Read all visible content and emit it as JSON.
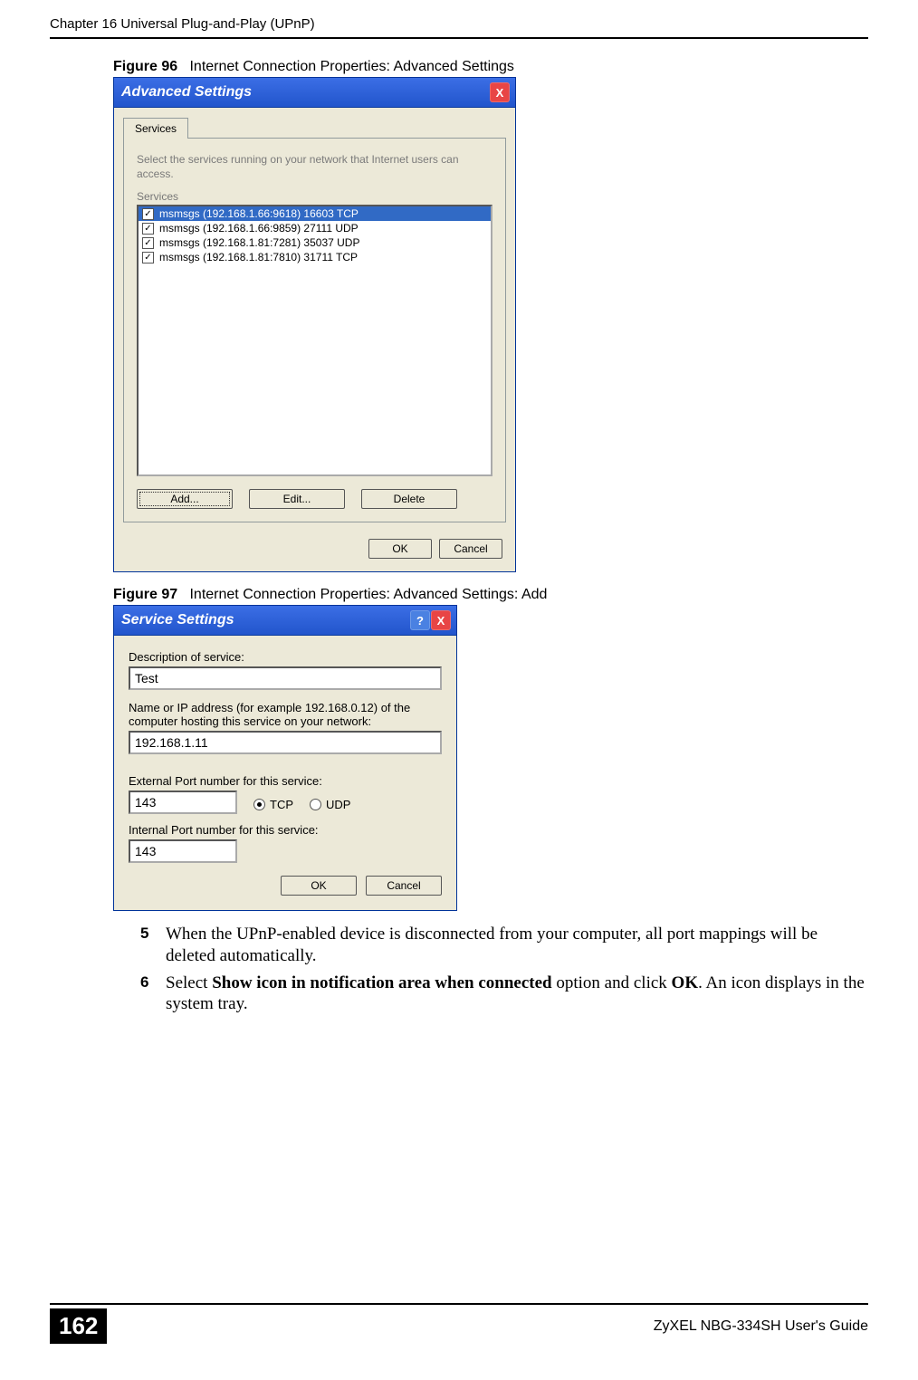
{
  "header": {
    "chapter": "Chapter 16 Universal Plug-and-Play (UPnP)"
  },
  "figure96": {
    "label": "Figure 96",
    "caption": "Internet Connection Properties: Advanced Settings"
  },
  "dlg1": {
    "title": "Advanced Settings",
    "tab": "Services",
    "instructions": "Select the services running on your network that Internet users can access.",
    "group": "Services",
    "items": [
      {
        "text": "msmsgs (192.168.1.66:9618) 16603 TCP",
        "selected": true
      },
      {
        "text": "msmsgs (192.168.1.66:9859) 27111 UDP",
        "selected": false
      },
      {
        "text": "msmsgs (192.168.1.81:7281) 35037 UDP",
        "selected": false
      },
      {
        "text": "msmsgs (192.168.1.81:7810) 31711 TCP",
        "selected": false
      }
    ],
    "btnAdd": "Add...",
    "btnEdit": "Edit...",
    "btnDelete": "Delete",
    "btnOK": "OK",
    "btnCancel": "Cancel"
  },
  "figure97": {
    "label": "Figure 97",
    "caption": "Internet Connection Properties: Advanced Settings: Add"
  },
  "dlg2": {
    "title": "Service Settings",
    "descLabel": "Description of service:",
    "descValue": "Test",
    "hostLabel": "Name or IP address (for example 192.168.0.12) of the computer hosting this service on your network:",
    "hostValue": "192.168.1.11",
    "extPortLabel": "External Port number for this service:",
    "extPortValue": "143",
    "tcpLabel": "TCP",
    "udpLabel": "UDP",
    "intPortLabel": "Internal Port number for this service:",
    "intPortValue": "143",
    "btnOK": "OK",
    "btnCancel": "Cancel"
  },
  "body": {
    "step5": "When the UPnP-enabled device is disconnected from your computer, all port mappings will be deleted automatically.",
    "step6a": "Select ",
    "step6bold": "Show icon in notification area when connected",
    "step6b": " option and click ",
    "step6ok": "OK",
    "step6c": ". An icon displays in the system tray."
  },
  "footer": {
    "pageNum": "162",
    "guide": "ZyXEL NBG-334SH User's Guide"
  }
}
